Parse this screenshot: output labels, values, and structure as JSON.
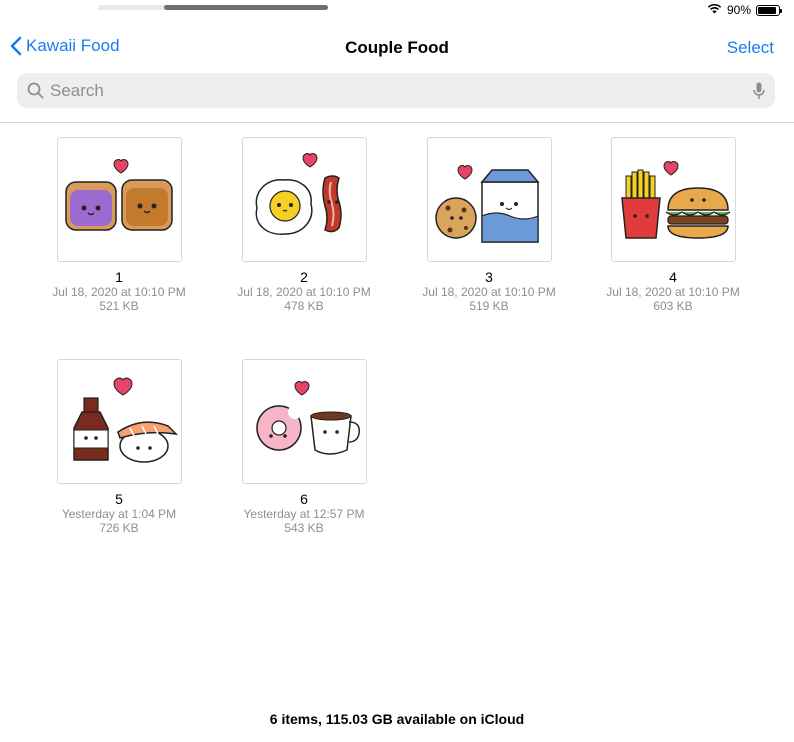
{
  "status": {
    "battery_percent": "90%",
    "battery_level": 0.9
  },
  "nav": {
    "back_label": "Kawaii Food",
    "title": "Couple Food",
    "select_label": "Select"
  },
  "search": {
    "placeholder": "Search"
  },
  "files": [
    {
      "name": "1",
      "date": "Jul 18, 2020 at 10:10 PM",
      "size": "521 KB",
      "image": "toast-couple"
    },
    {
      "name": "2",
      "date": "Jul 18, 2020 at 10:10 PM",
      "size": "478 KB",
      "image": "egg-bacon-couple"
    },
    {
      "name": "3",
      "date": "Jul 18, 2020 at 10:10 PM",
      "size": "519 KB",
      "image": "cookie-milk-couple"
    },
    {
      "name": "4",
      "date": "Jul 18, 2020 at 10:10 PM",
      "size": "603 KB",
      "image": "fries-burger-couple"
    },
    {
      "name": "5",
      "date": "Yesterday at 1:04 PM",
      "size": "726 KB",
      "image": "soy-sauce-sushi-couple"
    },
    {
      "name": "6",
      "date": "Yesterday at 12:57 PM",
      "size": "543 KB",
      "image": "donut-coffee-couple"
    }
  ],
  "footer": {
    "text": "6 items, 115.03 GB available on iCloud"
  },
  "colors": {
    "accent": "#1a7cf3",
    "secondary_text": "#8e8e93",
    "heart": "#e8446a"
  }
}
